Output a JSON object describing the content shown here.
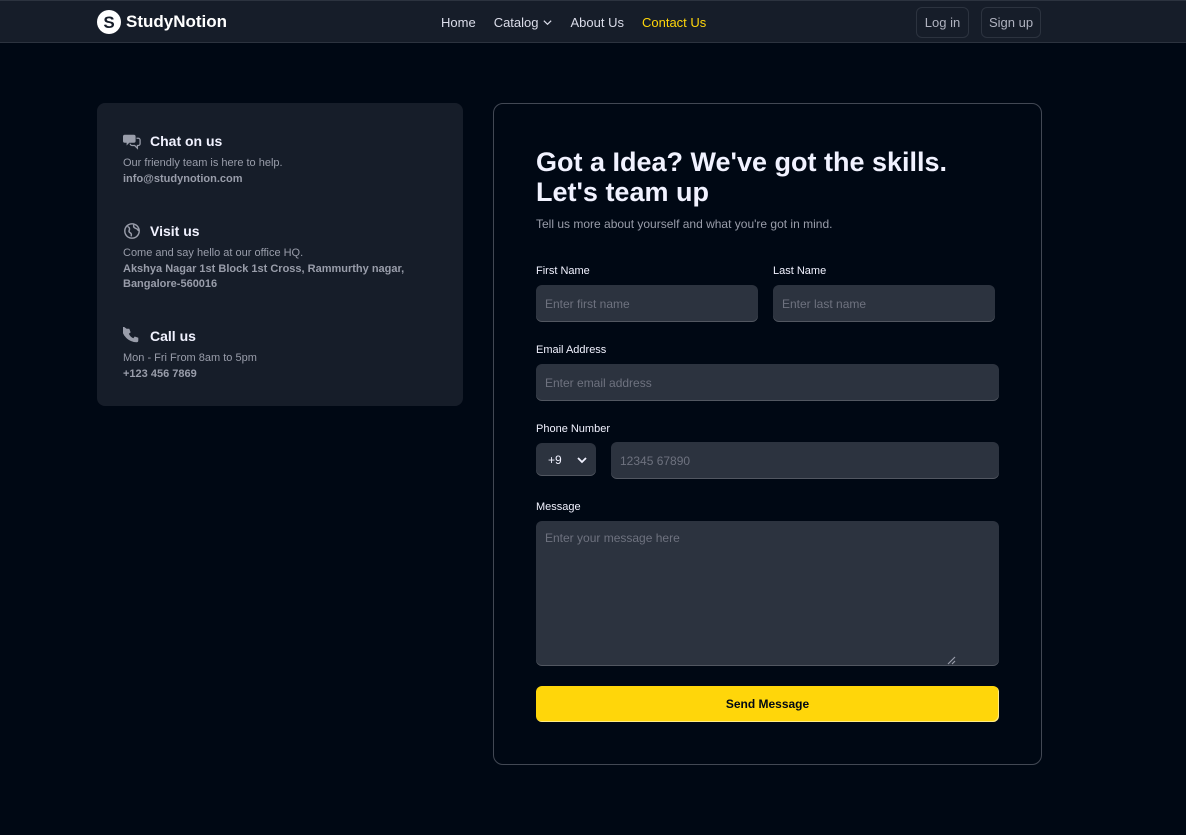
{
  "nav": {
    "logo_letter": "S",
    "logo_text": "StudyNotion",
    "links": [
      {
        "label": "Home"
      },
      {
        "label": "Catalog"
      },
      {
        "label": "About Us"
      },
      {
        "label": "Contact Us",
        "active": true
      }
    ],
    "login_label": "Log in",
    "signup_label": "Sign up"
  },
  "info": {
    "chat": {
      "icon": "chat-icon",
      "title": "Chat on us",
      "subtitle": "Our friendly team is here to help.",
      "detail": "info@studynotion.com"
    },
    "visit": {
      "icon": "globe-icon",
      "title": "Visit us",
      "subtitle": "Come and say hello at our office HQ.",
      "detail": "Akshya Nagar 1st Block 1st Cross, Rammurthy nagar, Bangalore-560016"
    },
    "call": {
      "icon": "phone-icon",
      "title": "Call us",
      "subtitle": "Mon - Fri From 8am to 5pm",
      "detail": "+123 456 7869"
    }
  },
  "form": {
    "title": "Got a Idea? We've got the skills. Let's team up",
    "description": "Tell us more about yourself and what you're got in mind.",
    "first_name": {
      "label": "First Name",
      "placeholder": "Enter first name"
    },
    "last_name": {
      "label": "Last Name",
      "placeholder": "Enter last name"
    },
    "email": {
      "label": "Email Address",
      "placeholder": "Enter email address"
    },
    "phone": {
      "label": "Phone Number",
      "code": "+9",
      "placeholder": "12345 67890"
    },
    "message": {
      "label": "Message",
      "placeholder": "Enter your message here"
    },
    "submit_label": "Send Message"
  },
  "colors": {
    "background": "#000814",
    "card": "#161d29",
    "field": "#2c333f",
    "accent": "#ffd60a"
  }
}
